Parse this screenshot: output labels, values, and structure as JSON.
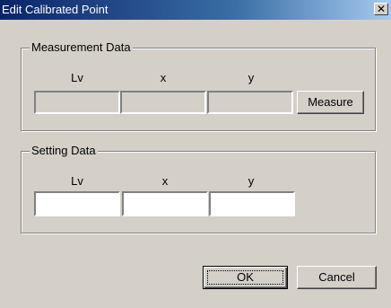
{
  "window": {
    "title": "Edit Calibrated Point",
    "close_glyph": "✕"
  },
  "measurement": {
    "group_title": "Measurement Data",
    "columns": [
      "Lv",
      "x",
      "y"
    ],
    "values": [
      "",
      "",
      ""
    ],
    "measure_label": "Measure"
  },
  "setting": {
    "group_title": "Setting Data",
    "columns": [
      "Lv",
      "x",
      "y"
    ],
    "values": [
      "",
      "",
      ""
    ]
  },
  "buttons": {
    "ok_label": "OK",
    "cancel_label": "Cancel"
  }
}
